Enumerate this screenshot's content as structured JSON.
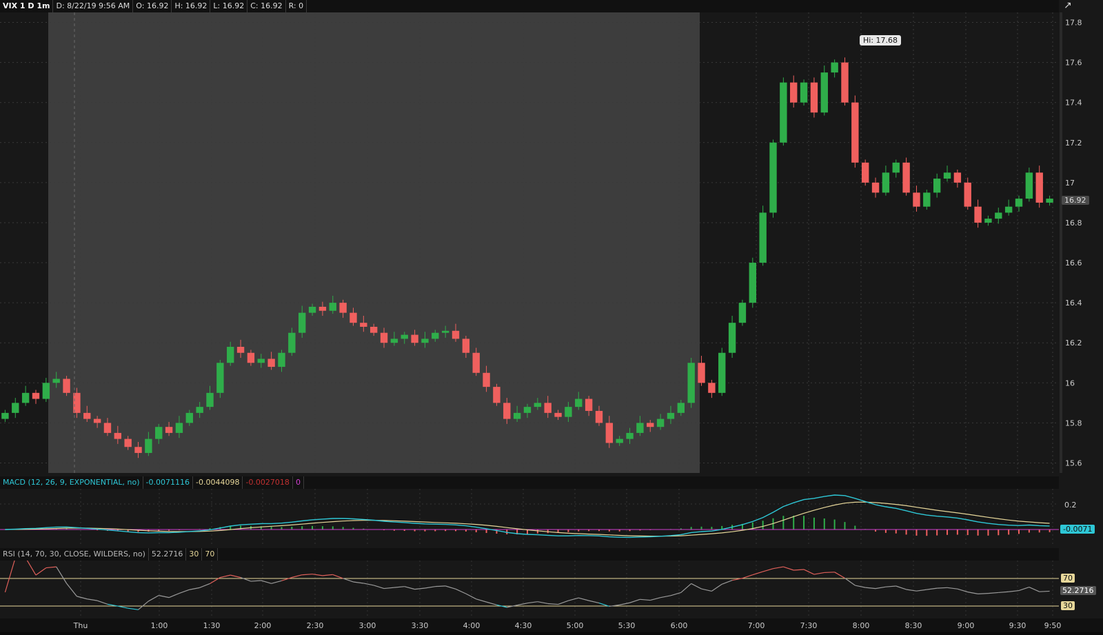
{
  "header": {
    "symbol": "VIX 1 D 1m",
    "date": "D: 8/22/19 9:56 AM",
    "open": "O: 16.92",
    "high": "H: 16.92",
    "low": "L: 16.92",
    "close": "C: 16.92",
    "range": "R: 0"
  },
  "macd": {
    "label": "MACD (12, 26, 9, EXPONENTIAL, no)",
    "value": "-0.0071116",
    "avg": "-0.0044098",
    "diff": "-0.0027018",
    "zero": "0",
    "current_tag": "-0.0071",
    "tick_label": "0.2"
  },
  "rsi": {
    "label": "RSI (14, 70, 30, CLOSE, WILDERS, no)",
    "value": "52.2716",
    "oversold": "30",
    "overbought": "70",
    "current_tag": "52.2716",
    "tag70": "70",
    "tag30": "30"
  },
  "price": {
    "hi_callout": "Hi: 17.68",
    "last_tag": "16.92"
  },
  "colors": {
    "up": "#2fae4a",
    "down": "#f0605e",
    "macd_line": "#2ec7d6",
    "avg_line": "#e7d79a",
    "rsi_line": "#9a9a9a",
    "premarket_shade": "#3d3d3d"
  },
  "chart_data": {
    "type": "candlestick",
    "ylim": [
      15.55,
      17.85
    ],
    "y_ticks": [
      "17.8",
      "17.6",
      "17.4",
      "17.2",
      "17",
      "16.8",
      "16.6",
      "16.4",
      "16.2",
      "16",
      "15.8",
      "15.6"
    ],
    "x_ticks": [
      "Thu",
      "1:00",
      "1:30",
      "2:00",
      "2:30",
      "3:00",
      "3:30",
      "4:00",
      "4:30",
      "5:00",
      "5:30",
      "6:00",
      "7:00",
      "7:30",
      "8:00",
      "8:30",
      "9:00",
      "9:30",
      "9:50"
    ],
    "closes": [
      15.85,
      15.9,
      15.95,
      15.92,
      16.0,
      16.02,
      15.95,
      15.85,
      15.82,
      15.8,
      15.75,
      15.72,
      15.68,
      15.65,
      15.72,
      15.78,
      15.75,
      15.8,
      15.85,
      15.88,
      15.95,
      16.1,
      16.18,
      16.15,
      16.1,
      16.12,
      16.08,
      16.15,
      16.25,
      16.35,
      16.38,
      16.36,
      16.4,
      16.35,
      16.3,
      16.28,
      16.25,
      16.2,
      16.22,
      16.24,
      16.2,
      16.22,
      16.25,
      16.26,
      16.22,
      16.15,
      16.05,
      15.98,
      15.9,
      15.82,
      15.85,
      15.88,
      15.9,
      15.85,
      15.83,
      15.88,
      15.92,
      15.86,
      15.8,
      15.7,
      15.72,
      15.75,
      15.8,
      15.78,
      15.82,
      15.85,
      15.9,
      16.1,
      16.0,
      15.95,
      16.15,
      16.3,
      16.4,
      16.6,
      16.85,
      17.2,
      17.5,
      17.4,
      17.5,
      17.35,
      17.55,
      17.6,
      17.4,
      17.1,
      17.0,
      16.95,
      17.05,
      17.1,
      16.95,
      16.88,
      16.95,
      17.02,
      17.05,
      17.0,
      16.88,
      16.8,
      16.82,
      16.85,
      16.88,
      16.92,
      17.05,
      16.9,
      16.92
    ]
  }
}
